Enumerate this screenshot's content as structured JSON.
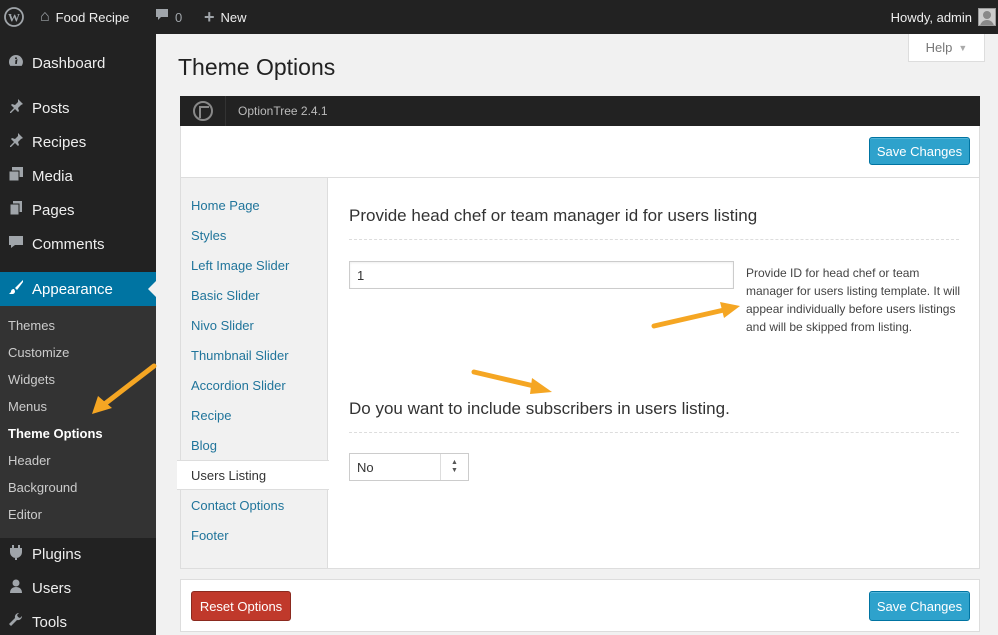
{
  "adminbar": {
    "site_name": "Food Recipe",
    "comments_count": "0",
    "new_label": "New",
    "howdy": "Howdy, admin"
  },
  "sidebar": {
    "items": [
      {
        "label": "Dashboard",
        "icon": "dashboard-icon"
      },
      {
        "label": "Posts",
        "icon": "pin-icon"
      },
      {
        "label": "Recipes",
        "icon": "pin-icon"
      },
      {
        "label": "Media",
        "icon": "media-icon"
      },
      {
        "label": "Pages",
        "icon": "pages-icon"
      },
      {
        "label": "Comments",
        "icon": "comment-icon"
      },
      {
        "label": "Appearance",
        "icon": "brush-icon"
      },
      {
        "label": "Plugins",
        "icon": "plug-icon"
      },
      {
        "label": "Users",
        "icon": "user-icon"
      },
      {
        "label": "Tools",
        "icon": "wrench-icon"
      }
    ],
    "submenu": [
      "Themes",
      "Customize",
      "Widgets",
      "Menus",
      "Theme Options",
      "Header",
      "Background",
      "Editor"
    ]
  },
  "help_label": "Help",
  "page_title": "Theme Options",
  "optiontree_version": "OptionTree 2.4.1",
  "save_label": "Save Changes",
  "reset_label": "Reset Options",
  "tabs": [
    "Home Page",
    "Styles",
    "Left Image Slider",
    "Basic Slider",
    "Nivo Slider",
    "Thumbnail Slider",
    "Accordion Slider",
    "Recipe",
    "Blog",
    "Users Listing",
    "Contact Options",
    "Footer"
  ],
  "settings": {
    "head_chef": {
      "title": "Provide head chef or team manager id for users listing",
      "value": "1",
      "description": "Provide ID for head chef or team manager for users listing template. It will appear individually before users listings and will be skipped from listing."
    },
    "subscribers": {
      "title": "Do you want to include subscribers in users listing.",
      "value": "No"
    }
  },
  "colors": {
    "adminbar": "#222222",
    "accent": "#0074a2",
    "primary_button": "#2ea2cc",
    "reset_button": "#c0392b",
    "annotation_arrow": "#f5a623"
  }
}
